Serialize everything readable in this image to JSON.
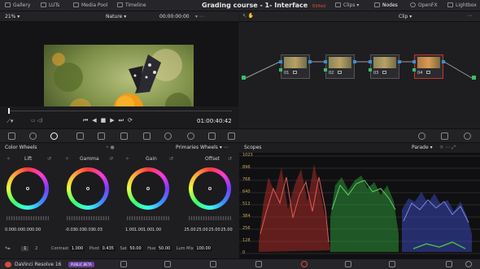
{
  "topbar": {
    "gallery": "Gallery",
    "luts": "LUTs",
    "media_pool": "Media Pool",
    "timeline": "Timeline",
    "project_title": "Grading course - 1- Interface",
    "edited": "Edited",
    "clips": "Clips",
    "nodes": "Nodes",
    "openfx": "OpenFX",
    "lightbox": "Lightbox"
  },
  "viewer": {
    "zoom": "21%",
    "clip_name": "Nature",
    "timecode_top": "00:00:00:00",
    "timecode": "01:00:40:42"
  },
  "node_editor": {
    "mode": "Clip",
    "nodes": [
      {
        "label": "01"
      },
      {
        "label": "02"
      },
      {
        "label": "03"
      },
      {
        "label": "04"
      }
    ]
  },
  "color_wheels": {
    "panel_title": "Color Wheels",
    "mode": "Primaries Wheels",
    "wheels": [
      {
        "name": "Lift",
        "values": [
          "0.00",
          "0.00",
          "0.00",
          "0.00"
        ]
      },
      {
        "name": "Gamma",
        "values": [
          "-0.03",
          "-0.03",
          "-0.03",
          "-0.03"
        ]
      },
      {
        "name": "Gain",
        "values": [
          "1.00",
          "1.00",
          "1.00",
          "1.00"
        ]
      },
      {
        "name": "Offset",
        "values": [
          "25.00",
          "25.00",
          "25.00",
          "25.00"
        ]
      }
    ],
    "page_1": "1",
    "page_2": "2",
    "contrast_label": "Contrast",
    "contrast_value": "1.000",
    "pivot_label": "Pivot",
    "pivot_value": "0.435",
    "sat_label": "Sat",
    "sat_value": "50.00",
    "hue_label": "Hue",
    "hue_value": "50.00",
    "lummix_label": "Lum Mix",
    "lummix_value": "100.00"
  },
  "scopes": {
    "title": "Scopes",
    "mode": "Parade",
    "ticks": [
      "1023",
      "896",
      "768",
      "640",
      "512",
      "384",
      "256",
      "128",
      "0"
    ]
  },
  "footer": {
    "app_name": "DaVinci Resolve 16",
    "beta": "PUBLIC BETA"
  },
  "colors": {
    "accent_red": "#e04a3c",
    "node_selected": "#c0392b",
    "beta_purple": "#6b3fa0"
  }
}
